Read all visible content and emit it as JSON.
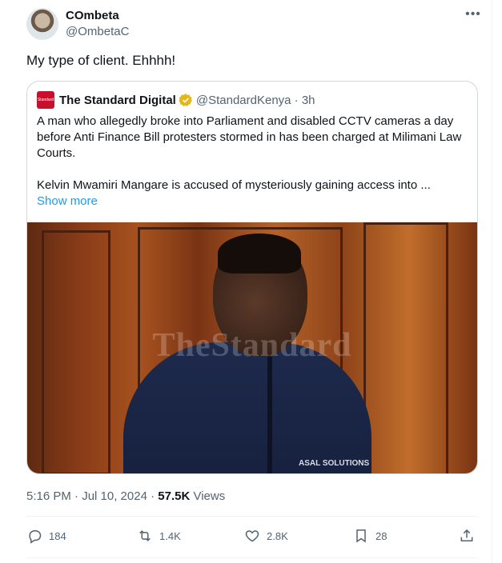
{
  "author": {
    "display_name": "COmbeta",
    "handle": "@OmbetaC"
  },
  "tweet": {
    "text": "My type of client. Ehhhh!"
  },
  "quote": {
    "logo_text": "Standard",
    "name": "The Standard Digital",
    "handle_time": "@StandardKenya · 3h",
    "paragraph1": "A man who allegedly broke into Parliament and disabled CCTV cameras a day before Anti Finance Bill protesters stormed in has been charged at Milimani Law Courts.",
    "paragraph2": "Kelvin Mwamiri Mangare is accused of mysteriously gaining access into ...",
    "show_more": "Show more",
    "watermark": "TheStandard",
    "shirt_logo": "ASAL SOLUTIONS"
  },
  "meta": {
    "timestamp": "5:16 PM · Jul 10, 2024 · ",
    "views_count": "57.5K",
    "views_label": " Views"
  },
  "actions": {
    "replies": "184",
    "reposts": "1.4K",
    "likes": "2.8K",
    "bookmarks": "28"
  },
  "colors": {
    "accent": "#1d9bf0",
    "secondary_text": "#536471",
    "verified_gold": "#e2b719",
    "brand_red": "#c8102e"
  },
  "icons": [
    "more-icon",
    "verified-icon",
    "reply-icon",
    "repost-icon",
    "like-icon",
    "bookmark-icon",
    "share-icon"
  ]
}
